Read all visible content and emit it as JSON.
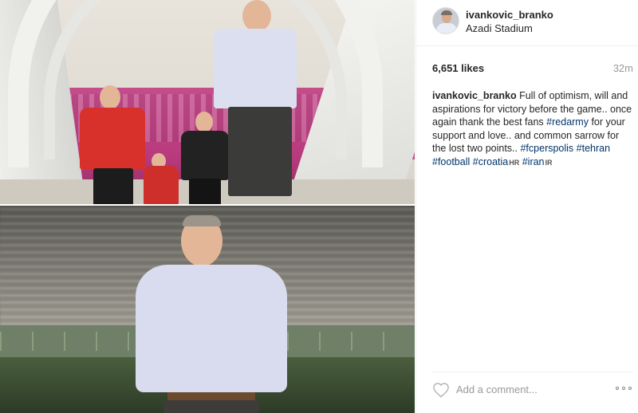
{
  "post": {
    "username": "ivankovic_branko",
    "location": "Azadi Stadium",
    "likes": "6,651 likes",
    "time_ago": "32m",
    "caption": {
      "user": "ivankovic_branko",
      "text_1": " Full of optimism, will and aspirations for victory before the game.. once again thank the best fans ",
      "tag_redarmy": "#redarmy",
      "text_2": " for your support and love.. and common sarrow for the lost two points.. ",
      "tag_fcperspolis": "#fcperspolis",
      "tag_tehran": "#tehran",
      "tag_football": "#football",
      "tag_croatia": "#croatia",
      "flag_hr": "HR",
      "tag_iran": "#iran",
      "flag_ir": "IR"
    },
    "comment_placeholder": "Add a comment..."
  },
  "icons": {
    "like": "heart-icon",
    "more": "more-options-icon"
  },
  "colors": {
    "hashtag": "#003569",
    "muted": "#999999",
    "text": "#262626"
  }
}
